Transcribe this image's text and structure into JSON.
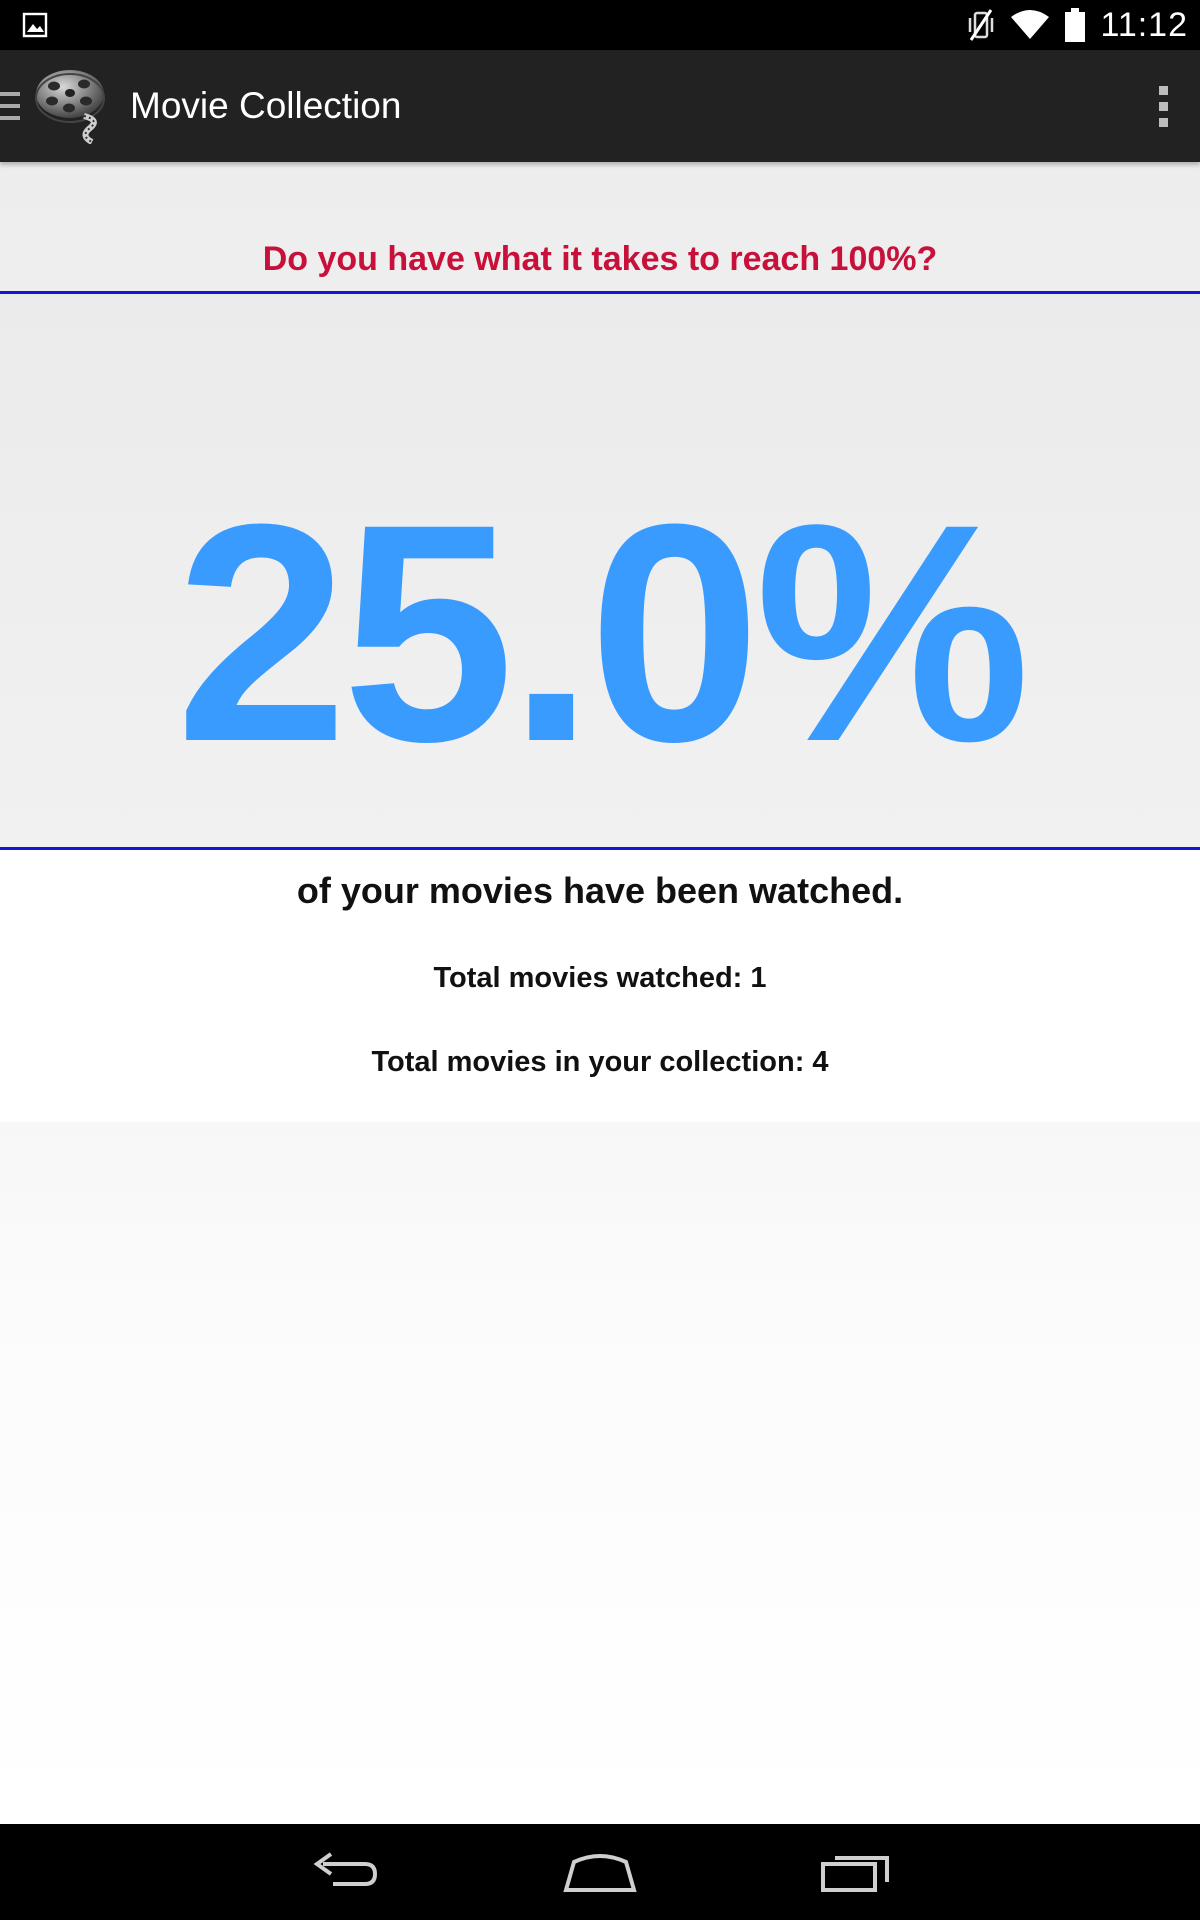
{
  "status_bar": {
    "time": "11:12",
    "icons": [
      "gallery-notification-icon",
      "vibrate-off-icon",
      "wifi-icon",
      "battery-icon"
    ]
  },
  "action_bar": {
    "title": "Movie Collection",
    "logo_icon": "film-reel-icon",
    "overflow_icon": "overflow-menu-icon",
    "drawer_icon": "drawer-indicator-icon"
  },
  "stats": {
    "challenge": "Do you have what it takes to reach 100%?",
    "percent": "25.0%",
    "caption": "of your movies have been watched.",
    "watched_line": "Total movies watched: 1",
    "total_line": "Total movies in your collection: 4"
  },
  "navigation": {
    "icons": [
      "back-icon",
      "home-icon",
      "recent-apps-icon"
    ]
  },
  "colors": {
    "action_bar": "#222222",
    "challenge_text": "#c8113a",
    "percent_text": "#3a9bff",
    "divider": "#1515d6"
  }
}
